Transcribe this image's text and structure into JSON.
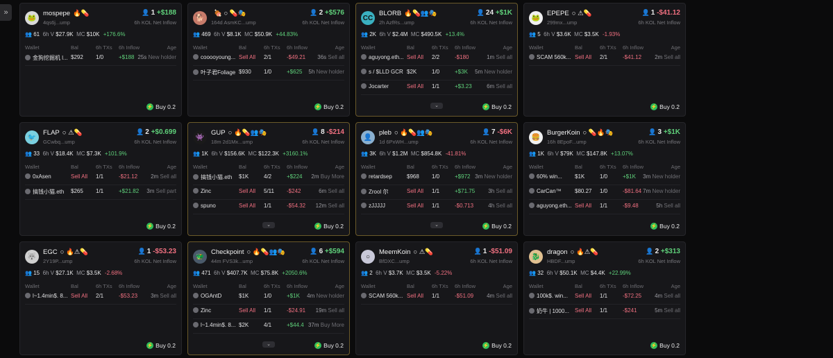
{
  "sidebar": {
    "toggle_icon": "double-chevron-right-icon",
    "toggle_label": "»"
  },
  "labels": {
    "inflow_label": "6h KOL Net Inflow",
    "col_wallet": "Wallet",
    "col_bal": "Bal",
    "col_txs": "6h TXs",
    "col_inflow": "6h Inflow",
    "col_age": "Age",
    "buy": "Buy 0.2",
    "v_prefix": "6h V",
    "mc_prefix": "MC"
  },
  "colors": {
    "positive": "#5fd07a",
    "negative": "#f07080",
    "gold": "#e5b84a",
    "blue": "#5a95e8",
    "buy": "#2fbf5a"
  },
  "cards": [
    {
      "name": "mospepe",
      "badges": "🔥💊",
      "sub": "4qs6j...ump",
      "kol_count": "1",
      "kol_value": "+$188",
      "kol_class": "pos",
      "usr_class": "",
      "holders": "61",
      "volume": "$27.9K",
      "mc": "$10K",
      "change": "+176.6%",
      "change_class": "pos",
      "avatar": "#d9d9d9",
      "avatar_txt": "🐸",
      "highlight": false,
      "more": false,
      "rows": [
        {
          "wallet": "金狗挖掘机 l...",
          "bal": "$292",
          "txs": "1/0",
          "inflow": "+$188",
          "inflow_class": "pos",
          "age": "25s",
          "note": "New holder",
          "sell": false
        }
      ]
    },
    {
      "name": "",
      "badges": "🍖 ○ 💊🎭",
      "sub": "164d AsmKC...ump",
      "kol_count": "2",
      "kol_value": "+$576",
      "kol_class": "pos",
      "usr_class": "",
      "holders": "469",
      "volume": "$8.1K",
      "mc": "$50.9K",
      "change": "+44.83%",
      "change_class": "pos",
      "avatar": "#c77b6a",
      "avatar_txt": "🐕",
      "highlight": false,
      "more": false,
      "rows": [
        {
          "wallet": "cooooyoung...",
          "bal": "Sell All",
          "txs": "2/1",
          "inflow": "-$49.21",
          "inflow_class": "neg",
          "age": "36s",
          "note": "Sell all",
          "sell": true
        },
        {
          "wallet": "叶子君Foliage",
          "bal": "$930",
          "txs": "1/0",
          "inflow": "+$625",
          "inflow_class": "pos",
          "age": "5h",
          "note": "New holder",
          "sell": false
        }
      ]
    },
    {
      "name": "BLORB",
      "badges": "🔥💊👥🎭",
      "sub": "2h AzfRs...ump",
      "kol_count": "24",
      "kol_value": "+$1K",
      "kol_class": "pos",
      "usr_class": "gold",
      "holders": "2K",
      "volume": "$2.4M",
      "mc": "$490.5K",
      "change": "+13.4%",
      "change_class": "pos",
      "avatar": "#3ab0c0",
      "avatar_txt": "CC",
      "highlight": true,
      "more": true,
      "rows": [
        {
          "wallet": "aguyong.eth...",
          "bal": "Sell All",
          "txs": "2/2",
          "inflow": "-$180",
          "inflow_class": "neg",
          "age": "1m",
          "note": "Sell all",
          "sell": true
        },
        {
          "wallet": "s / $LLD GCR",
          "bal": "$2K",
          "txs": "1/0",
          "inflow": "+$3K",
          "inflow_class": "pos",
          "age": "5m",
          "note": "New holder",
          "sell": false
        },
        {
          "wallet": "Jocarter",
          "bal": "Sell All",
          "txs": "1/1",
          "inflow": "+$3.23",
          "inflow_class": "pos",
          "age": "6m",
          "note": "Sell all",
          "sell": true
        }
      ]
    },
    {
      "name": "EPEPE",
      "badges": "○ ⚠💊",
      "sub": "299mx...ump",
      "kol_count": "1",
      "kol_value": "-$41.12",
      "kol_class": "neg",
      "usr_class": "",
      "holders": "5",
      "volume": "$3.6K",
      "mc": "$3.5K",
      "change": "-1.93%",
      "change_class": "neg",
      "avatar": "#f0f0f0",
      "avatar_txt": "🐸",
      "highlight": false,
      "more": false,
      "rows": [
        {
          "wallet": "SCAM 560k...",
          "bal": "Sell All",
          "txs": "2/1",
          "inflow": "-$41.12",
          "inflow_class": "neg",
          "age": "2m",
          "note": "Sell all",
          "sell": true
        }
      ]
    },
    {
      "name": "FLAP",
      "badges": "○ ⚠💊",
      "sub": "GCwbq...ump",
      "kol_count": "2",
      "kol_value": "+$0.699",
      "kol_class": "pos",
      "usr_class": "",
      "holders": "33",
      "volume": "$18.4K",
      "mc": "$7.3K",
      "change": "+101.9%",
      "change_class": "pos",
      "avatar": "#7ad0e0",
      "avatar_txt": "🐦",
      "highlight": false,
      "more": false,
      "rows": [
        {
          "wallet": "0xAsen",
          "bal": "Sell All",
          "txs": "1/1",
          "inflow": "-$21.12",
          "inflow_class": "neg",
          "age": "2m",
          "note": "Sell all",
          "sell": true
        },
        {
          "wallet": "搞钱小猫.eth",
          "bal": "$265",
          "txs": "1/1",
          "inflow": "+$21.82",
          "inflow_class": "pos",
          "age": "3m",
          "note": "Sell part",
          "sell": false
        }
      ]
    },
    {
      "name": "GUP",
      "badges": "○ 🔥💊👥🎭",
      "sub": "18m 2d1Mx...ump",
      "kol_count": "8",
      "kol_value": "-$214",
      "kol_class": "neg",
      "usr_class": "gold",
      "holders": "1K",
      "volume": "$156.6K",
      "mc": "$122.3K",
      "change": "+3160.1%",
      "change_class": "pos",
      "avatar": "#1a1a1a",
      "avatar_txt": "👾",
      "highlight": true,
      "more": true,
      "rows": [
        {
          "wallet": "搞钱小猫.eth",
          "bal": "$1K",
          "txs": "4/2",
          "inflow": "+$224",
          "inflow_class": "pos",
          "age": "2m",
          "note": "Buy More",
          "sell": false
        },
        {
          "wallet": "Zinc",
          "bal": "Sell All",
          "txs": "5/11",
          "inflow": "-$242",
          "inflow_class": "neg",
          "age": "6m",
          "note": "Sell all",
          "sell": true
        },
        {
          "wallet": "spuno",
          "bal": "Sell All",
          "txs": "1/1",
          "inflow": "-$54.32",
          "inflow_class": "neg",
          "age": "12m",
          "note": "Sell all",
          "sell": true
        }
      ]
    },
    {
      "name": "pleb",
      "badges": "○ 🔥💊👥🎭",
      "sub": "1d 6PxWH...ump",
      "kol_count": "7",
      "kol_value": "-$6K",
      "kol_class": "neg",
      "usr_class": "gold",
      "holders": "3K",
      "volume": "$1.2M",
      "mc": "$854.8K",
      "change": "-41.81%",
      "change_class": "neg",
      "avatar": "#8ab0d0",
      "avatar_txt": "👤",
      "highlight": true,
      "more": true,
      "rows": [
        {
          "wallet": "retardsep",
          "bal": "$968",
          "txs": "1/0",
          "inflow": "+$972",
          "inflow_class": "pos",
          "age": "3m",
          "note": "New holder",
          "sell": false
        },
        {
          "wallet": "Zrool 尔",
          "bal": "Sell All",
          "txs": "1/1",
          "inflow": "+$71.75",
          "inflow_class": "pos",
          "age": "3h",
          "note": "Sell all",
          "sell": true
        },
        {
          "wallet": "zJJJJJ",
          "bal": "Sell All",
          "txs": "1/1",
          "inflow": "-$0.713",
          "inflow_class": "neg",
          "age": "4h",
          "note": "Sell all",
          "sell": true
        }
      ]
    },
    {
      "name": "BurgerKoin",
      "badges": "○ 💊🔥🎭",
      "sub": "16h 8EpoF...ump",
      "kol_count": "3",
      "kol_value": "+$1K",
      "kol_class": "pos",
      "usr_class": "blue",
      "holders": "1K",
      "volume": "$79K",
      "mc": "$147.8K",
      "change": "+13.07%",
      "change_class": "pos",
      "avatar": "#f0f0f0",
      "avatar_txt": "🍔",
      "highlight": false,
      "more": false,
      "rows": [
        {
          "wallet": "60% win...",
          "bal": "$1K",
          "txs": "1/0",
          "inflow": "+$1K",
          "inflow_class": "pos",
          "age": "3m",
          "note": "New holder",
          "sell": false
        },
        {
          "wallet": "CarCan™",
          "bal": "$80.27",
          "txs": "1/0",
          "inflow": "-$81.64",
          "inflow_class": "neg",
          "age": "7m",
          "note": "New holder",
          "sell": false
        },
        {
          "wallet": "aguyong.eth...",
          "bal": "Sell All",
          "txs": "1/1",
          "inflow": "-$9.48",
          "inflow_class": "neg",
          "age": "5h",
          "note": "Sell all",
          "sell": true
        }
      ]
    },
    {
      "name": "EGC",
      "badges": "○ 🔥⚠💊",
      "sub": "2Y19P...ump",
      "kol_count": "1",
      "kol_value": "-$53.23",
      "kol_class": "neg",
      "usr_class": "",
      "holders": "15",
      "volume": "$27.1K",
      "mc": "$3.5K",
      "change": "-2.68%",
      "change_class": "neg",
      "avatar": "#d0d0d0",
      "avatar_txt": "🐺",
      "highlight": false,
      "more": false,
      "rows": [
        {
          "wallet": "l~1.4min$. 8...",
          "bal": "Sell All",
          "txs": "2/1",
          "inflow": "-$53.23",
          "inflow_class": "neg",
          "age": "3m",
          "note": "Sell all",
          "sell": true
        }
      ]
    },
    {
      "name": "Checkpoint",
      "badges": "○ 🔥💊👥🎭",
      "sub": "44m FVS3k...ump",
      "kol_count": "6",
      "kol_value": "+$594",
      "kol_class": "pos",
      "usr_class": "gold",
      "holders": "471",
      "volume": "$407.7K",
      "mc": "$75.8K",
      "change": "+2050.6%",
      "change_class": "pos",
      "avatar": "#4a5a6a",
      "avatar_txt": "🐲",
      "highlight": true,
      "more": true,
      "rows": [
        {
          "wallet": "OGAntD",
          "bal": "$1K",
          "txs": "1/0",
          "inflow": "+$1K",
          "inflow_class": "pos",
          "age": "4m",
          "note": "New holder",
          "sell": false
        },
        {
          "wallet": "Zinc",
          "bal": "Sell All",
          "txs": "1/1",
          "inflow": "-$24.91",
          "inflow_class": "neg",
          "age": "19m",
          "note": "Sell all",
          "sell": true
        },
        {
          "wallet": "l~1.4min$. 8...",
          "bal": "$2K",
          "txs": "4/1",
          "inflow": "+$44.4",
          "inflow_class": "pos",
          "age": "37m",
          "note": "Buy More",
          "sell": false
        }
      ]
    },
    {
      "name": "MeemKoin",
      "badges": "○ ⚠💊",
      "sub": "BfDXC...ump",
      "kol_count": "1",
      "kol_value": "-$51.09",
      "kol_class": "neg",
      "usr_class": "",
      "holders": "2",
      "volume": "$3.7K",
      "mc": "$3.5K",
      "change": "-5.22%",
      "change_class": "neg",
      "avatar": "#c8c8d8",
      "avatar_txt": "○",
      "highlight": false,
      "more": false,
      "rows": [
        {
          "wallet": "SCAM 560k...",
          "bal": "Sell All",
          "txs": "1/1",
          "inflow": "-$51.09",
          "inflow_class": "neg",
          "age": "4m",
          "note": "Sell all",
          "sell": true
        }
      ]
    },
    {
      "name": "dragon",
      "badges": "○ 🔥⚠💊",
      "sub": "HBDF...ump",
      "kol_count": "2",
      "kol_value": "+$313",
      "kol_class": "pos",
      "usr_class": "",
      "holders": "32",
      "volume": "$50.1K",
      "mc": "$4.4K",
      "change": "+22.99%",
      "change_class": "pos",
      "avatar": "#e0c090",
      "avatar_txt": "🐉",
      "highlight": false,
      "more": false,
      "rows": [
        {
          "wallet": "100k$. win...",
          "bal": "Sell All",
          "txs": "1/1",
          "inflow": "-$72.25",
          "inflow_class": "neg",
          "age": "4m",
          "note": "Sell all",
          "sell": true
        },
        {
          "wallet": "奶牛 | 1000...",
          "bal": "Sell All",
          "txs": "1/1",
          "inflow": "-$241",
          "inflow_class": "neg",
          "age": "5m",
          "note": "Sell all",
          "sell": true
        }
      ]
    }
  ]
}
